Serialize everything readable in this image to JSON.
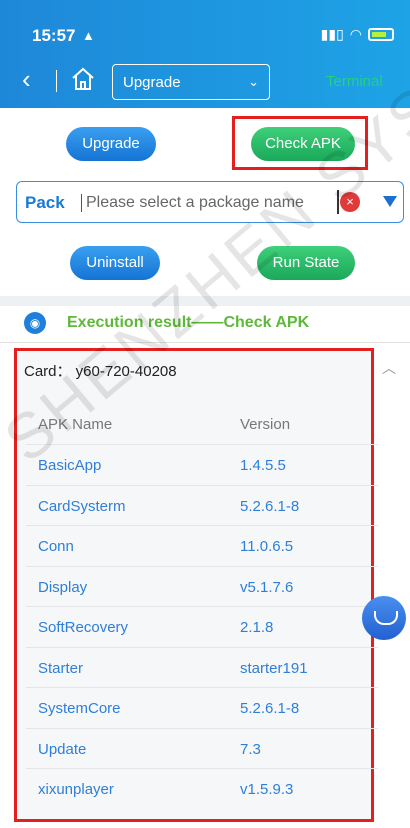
{
  "status": {
    "time": "15:57",
    "person_glyph": "▲",
    "signal": "▮▮▯",
    "wifi": "◠"
  },
  "nav": {
    "back": "‹",
    "select_value": "Upgrade",
    "select_chevron": "⌄",
    "terminal_label": "Terminal"
  },
  "actions": {
    "upgrade": "Upgrade",
    "check_apk": "Check APK",
    "uninstall": "Uninstall",
    "run_state": "Run State"
  },
  "pack": {
    "label": "Pack",
    "placeholder": "Please select a package name",
    "clear": "×"
  },
  "execution": {
    "icon": "◉",
    "title": "Execution result——Check APK"
  },
  "card": {
    "title": "Card：  y60-720-40208",
    "chevron": "︿",
    "headers": {
      "name": "APK Name",
      "version": "Version"
    },
    "rows": [
      {
        "name": "BasicApp",
        "version": "1.4.5.5"
      },
      {
        "name": "CardSysterm",
        "version": "5.2.6.1-8"
      },
      {
        "name": "Conn",
        "version": "11.0.6.5"
      },
      {
        "name": "Display",
        "version": "v5.1.7.6"
      },
      {
        "name": "SoftRecovery",
        "version": "2.1.8"
      },
      {
        "name": "Starter",
        "version": "starter191"
      },
      {
        "name": "SystemCore",
        "version": "5.2.6.1-8"
      },
      {
        "name": "Update",
        "version": "7.3"
      },
      {
        "name": "xixunplayer",
        "version": "v1.5.9.3"
      }
    ]
  },
  "watermark": "SHENZHEN SYSOLUTION",
  "colors": {
    "header": "#1e88d8",
    "highlight_box": "#e51e1e",
    "link": "#2f7fd8",
    "accent_green": "#1aa85a"
  }
}
